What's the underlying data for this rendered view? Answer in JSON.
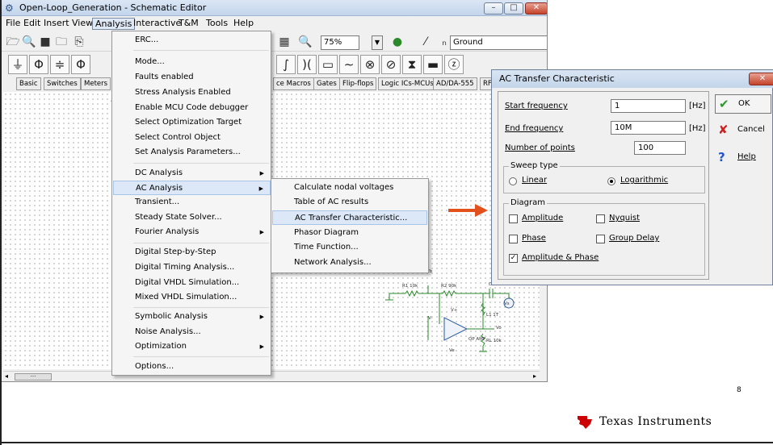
{
  "window": {
    "title": "Open-Loop_Generation - Schematic Editor",
    "minimize": "–",
    "maximize": "□",
    "close": "✕"
  },
  "menubar": [
    "File",
    "Edit",
    "Insert",
    "View",
    "Analysis",
    "Interactive",
    "T&M",
    "Tools",
    "Help"
  ],
  "toolbar": {
    "zoom": "75%",
    "ground": "Ground"
  },
  "component_tabs": [
    "Basic",
    "Switches",
    "Meters"
  ],
  "component_tabs_right": [
    "ce Macros",
    "Gates",
    "Flip-flops",
    "Logic ICs-MCUs",
    "AD/DA-555",
    "RF"
  ],
  "analysis_menu": [
    {
      "label": "ERC..."
    },
    {
      "label": "Mode..."
    },
    {
      "label": "Faults enabled"
    },
    {
      "label": "Stress Analysis Enabled"
    },
    {
      "label": "Enable MCU Code debugger"
    },
    {
      "label": "Select Optimization Target"
    },
    {
      "label": "Select Control Object"
    },
    {
      "label": "Set Analysis Parameters..."
    },
    {
      "label": "DC Analysis"
    },
    {
      "label": "AC Analysis"
    },
    {
      "label": "Transient..."
    },
    {
      "label": "Steady State Solver..."
    },
    {
      "label": "Fourier Analysis"
    },
    {
      "label": "Digital Step-by-Step"
    },
    {
      "label": "Digital Timing Analysis..."
    },
    {
      "label": "Digital VHDL Simulation..."
    },
    {
      "label": "Mixed VHDL Simulation..."
    },
    {
      "label": "Symbolic Analysis"
    },
    {
      "label": "Noise Analysis..."
    },
    {
      "label": "Optimization"
    },
    {
      "label": "Options..."
    }
  ],
  "ac_submenu": [
    "Calculate nodal voltages",
    "Table of AC results",
    "AC Transfer Characteristic...",
    "Phasor Diagram",
    "Time Function...",
    "Network Analysis..."
  ],
  "dialog": {
    "title": "AC Transfer Characteristic",
    "close": "✕",
    "start_frequency": {
      "label": "Start frequency",
      "value": "1",
      "unit": "[Hz]"
    },
    "end_frequency": {
      "label": "End frequency",
      "value": "10M",
      "unit": "[Hz]"
    },
    "number_of_points": {
      "label": "Number of points",
      "value": "100"
    },
    "sweep_type": {
      "title": "Sweep type",
      "linear": "Linear",
      "logarithmic": "Logarithmic",
      "selected": "logarithmic"
    },
    "diagram": {
      "title": "Diagram",
      "amplitude": "Amplitude",
      "nyquist": "Nyquist",
      "phase": "Phase",
      "group_delay": "Group Delay",
      "amplitude_phase": "Amplitude & Phase",
      "checked": "amplitude_phase"
    },
    "ok": "OK",
    "cancel": "Cancel",
    "help": "Help"
  },
  "circuit_labels": {
    "vb": "Vb",
    "r1": "R1 10k",
    "r2": "R2 90k",
    "c": "C",
    "l1": "L1 1T",
    "vplus": "V+",
    "vminus": "V-",
    "ve": "Ve",
    "vo": "Vo",
    "vs": "Vs",
    "opamp": "OP AMP",
    "rl": "RL 10k"
  },
  "slide": {
    "page_number": "8",
    "brand": "Texas Instruments"
  },
  "colors": {
    "accent_arrow": "#e2501c",
    "ti_red": "#cc0000",
    "highlight": "#dce8f7"
  }
}
